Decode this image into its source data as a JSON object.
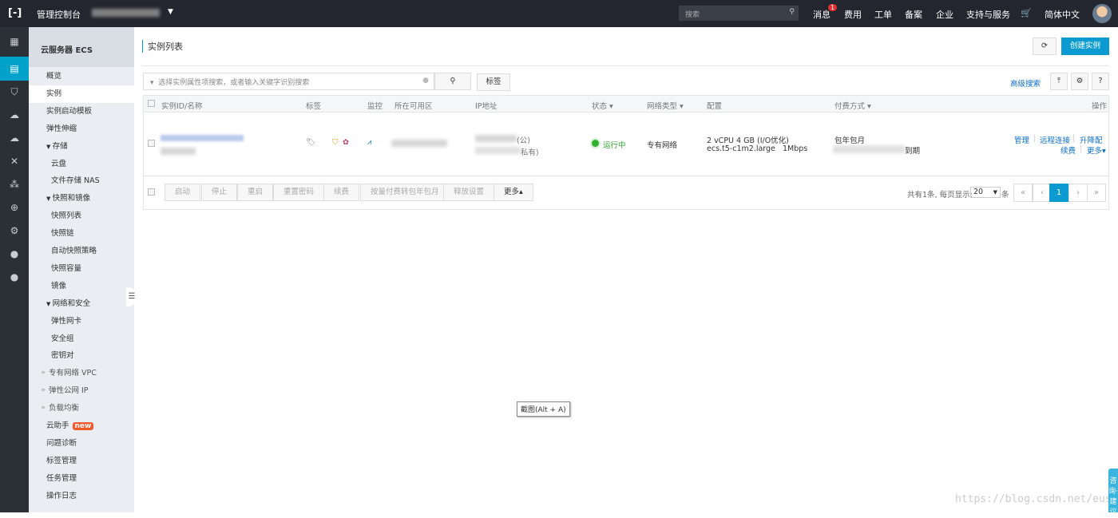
{
  "topbar": {
    "logo": "[-]",
    "title": "管理控制台",
    "search_placeholder": "搜索",
    "messages": "消息",
    "message_count": "1",
    "nav": [
      "费用",
      "工单",
      "备案",
      "企业",
      "支持与服务"
    ],
    "cart": "🛒",
    "language": "简体中文"
  },
  "rail": [
    "grid",
    "server",
    "shield",
    "cloud",
    "cloud-upload",
    "network",
    "nodes",
    "globe",
    "gear",
    "dot",
    "dot"
  ],
  "sidebar": {
    "header": "云服务器 ECS",
    "items": [
      {
        "label": "概览",
        "type": "item"
      },
      {
        "label": "实例",
        "type": "item",
        "active": true
      },
      {
        "label": "实例启动模板",
        "type": "item"
      },
      {
        "label": "弹性伸缩",
        "type": "item"
      },
      {
        "label": "存储",
        "type": "group"
      },
      {
        "label": "云盘",
        "type": "sub"
      },
      {
        "label": "文件存储 NAS",
        "type": "sub"
      },
      {
        "label": "快照和镜像",
        "type": "group"
      },
      {
        "label": "快照列表",
        "type": "sub"
      },
      {
        "label": "快照链",
        "type": "sub"
      },
      {
        "label": "自动快照策略",
        "type": "sub"
      },
      {
        "label": "快照容量",
        "type": "sub"
      },
      {
        "label": "镜像",
        "type": "sub"
      },
      {
        "label": "网络和安全",
        "type": "group"
      },
      {
        "label": "弹性网卡",
        "type": "sub"
      },
      {
        "label": "安全组",
        "type": "sub"
      },
      {
        "label": "密钥对",
        "type": "sub"
      },
      {
        "label": "专有网络 VPC",
        "type": "link"
      },
      {
        "label": "弹性公网 IP",
        "type": "link"
      },
      {
        "label": "负载均衡",
        "type": "link"
      },
      {
        "label": "云助手",
        "type": "item",
        "badge": "new"
      },
      {
        "label": "问题诊断",
        "type": "item"
      },
      {
        "label": "标签管理",
        "type": "item"
      },
      {
        "label": "任务管理",
        "type": "item"
      },
      {
        "label": "操作日志",
        "type": "item"
      }
    ]
  },
  "main": {
    "title": "实例列表",
    "create": "创建实例",
    "search_placeholder": "选择实例属性项搜索，或者输入关键字识别搜索",
    "tag_button": "标签",
    "advanced_search": "高级搜索",
    "help": "?",
    "columns": [
      "实例ID/名称",
      "标签",
      "监控",
      "所在可用区",
      "IP地址",
      "状态 ▾",
      "网络类型 ▾",
      "配置",
      "付费方式 ▾",
      "操作"
    ],
    "row": {
      "ip_public_suffix": "(公)",
      "ip_private_suffix": "私有)",
      "status": "运行中",
      "network": "专有网络",
      "config_line1": "2 vCPU 4 GB (I/O优化)",
      "config_line2": "ecs.t5-c1m2.large   1Mbps",
      "billing": "包年包月",
      "expire_suffix": "到期",
      "actions": [
        "管理",
        "远程连接",
        "升降配",
        "续费",
        "更多▾"
      ]
    },
    "bulk_buttons": [
      "启动",
      "停止",
      "重启",
      "重置密码",
      "续费",
      "按量付费转包年包月",
      "释放设置"
    ],
    "more": "更多▴",
    "pagination": {
      "summary": "共有1条, 每页显示:",
      "page_size": "20",
      "unit": "条",
      "first": "«",
      "prev": "‹",
      "current": "1",
      "next": "›",
      "last": "»"
    }
  },
  "tooltip": "截图(Alt + A)",
  "consult": "咨询·建议",
  "watermark": "https://blog.csdn.net/euss"
}
